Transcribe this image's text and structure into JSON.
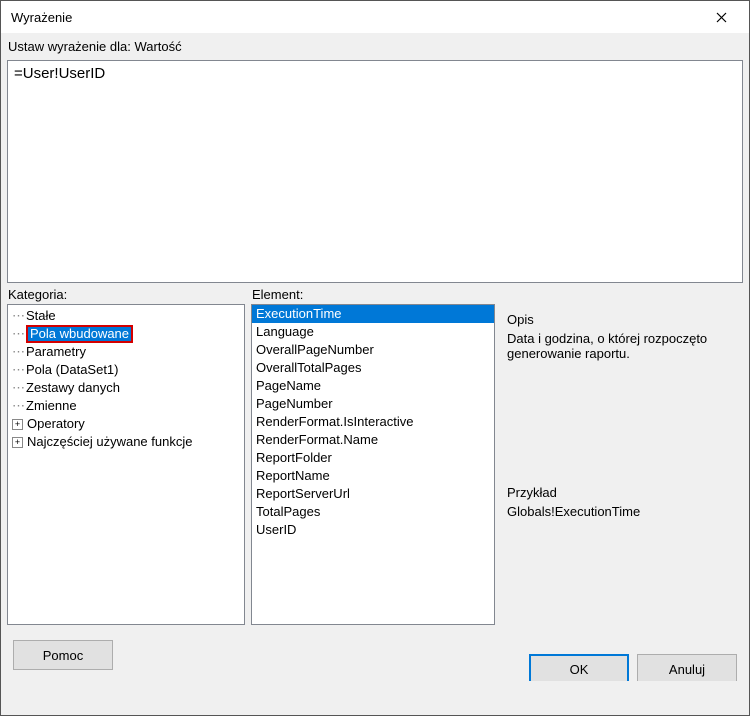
{
  "window": {
    "title": "Wyrażenie"
  },
  "expr": {
    "label": "Ustaw wyrażenie dla: Wartość",
    "value": "=User!UserID"
  },
  "category": {
    "label": "Kategoria:",
    "items": [
      {
        "label": "Stałe",
        "level": 1,
        "expand": null,
        "selected": false
      },
      {
        "label": "Pola wbudowane",
        "level": 1,
        "expand": null,
        "selected": true
      },
      {
        "label": "Parametry",
        "level": 1,
        "expand": null,
        "selected": false
      },
      {
        "label": "Pola (DataSet1)",
        "level": 1,
        "expand": null,
        "selected": false
      },
      {
        "label": "Zestawy danych",
        "level": 1,
        "expand": null,
        "selected": false
      },
      {
        "label": "Zmienne",
        "level": 1,
        "expand": null,
        "selected": false
      },
      {
        "label": "Operatory",
        "level": 0,
        "expand": "+",
        "selected": false
      },
      {
        "label": "Najczęściej używane funkcje",
        "level": 0,
        "expand": "+",
        "selected": false
      }
    ]
  },
  "element": {
    "label": "Element:",
    "items": [
      "ExecutionTime",
      "Language",
      "OverallPageNumber",
      "OverallTotalPages",
      "PageName",
      "PageNumber",
      "RenderFormat.IsInteractive",
      "RenderFormat.Name",
      "ReportFolder",
      "ReportName",
      "ReportServerUrl",
      "TotalPages",
      "UserID"
    ],
    "selected_index": 0
  },
  "description": {
    "label": "Opis",
    "text": "Data i godzina, o której rozpoczęto generowanie raportu."
  },
  "example": {
    "label": "Przykład",
    "text": "Globals!ExecutionTime"
  },
  "buttons": {
    "help": "Pomoc",
    "ok": "OK",
    "cancel": "Anuluj"
  }
}
